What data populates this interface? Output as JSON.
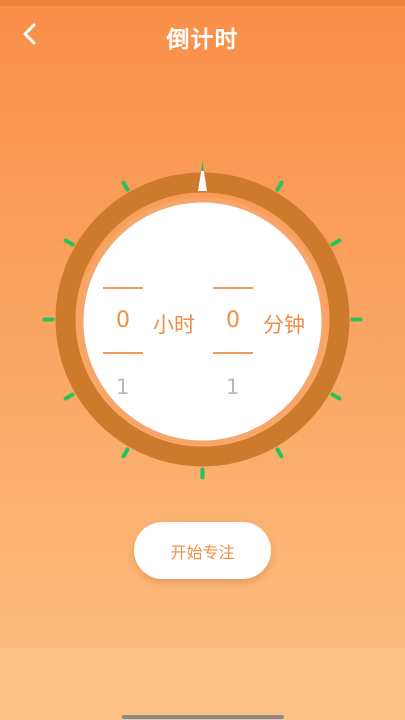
{
  "header": {
    "title": "倒计时",
    "back_icon": "chevron-left-icon"
  },
  "timer": {
    "hours": {
      "value": "0",
      "unit": "小时",
      "next": "1"
    },
    "minutes": {
      "value": "0",
      "unit": "分钟",
      "next": "1"
    }
  },
  "actions": {
    "start_label": "开始专注"
  },
  "colors": {
    "accent": "#ef8e44",
    "ring": "#cd7a2c",
    "tick": "#27c35a",
    "pointer": "#27c35a"
  }
}
